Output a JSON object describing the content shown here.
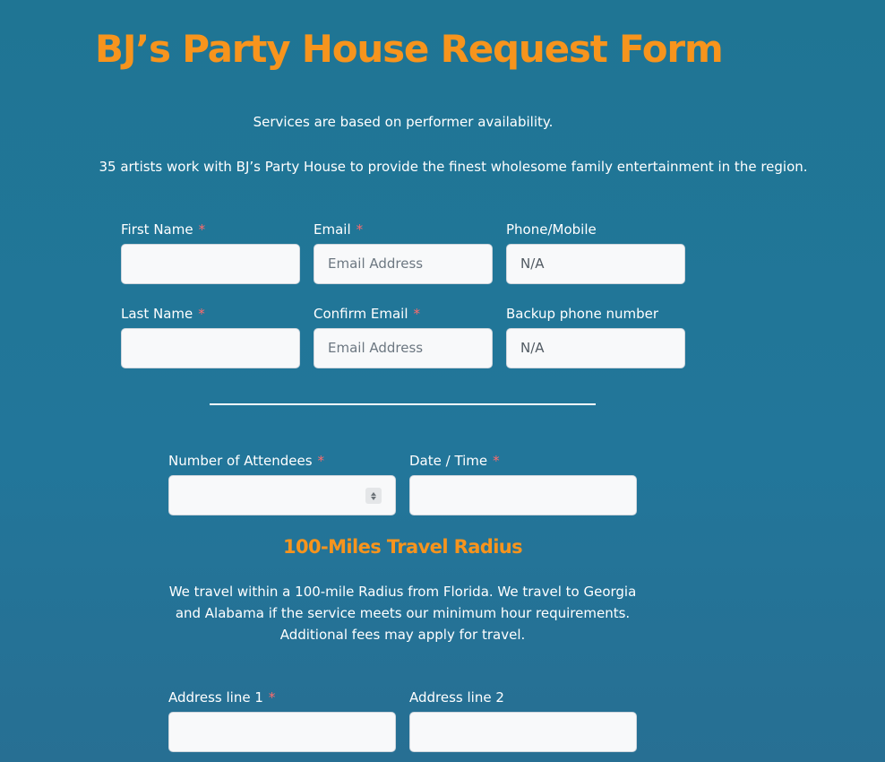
{
  "header": {
    "title": "BJ’s Party House Request Form",
    "intro_line_1": "Services are based on performer availability.",
    "intro_line_2": "35 artists work with BJ’s Party House to provide the finest wholesome family entertainment in the region."
  },
  "required_marker": "*",
  "contact_fields": {
    "first_name": {
      "label": "First Name",
      "value": ""
    },
    "email": {
      "label": "Email",
      "placeholder": "Email Address"
    },
    "phone": {
      "label": "Phone/Mobile",
      "value": "N/A"
    },
    "last_name": {
      "label": "Last Name",
      "value": ""
    },
    "confirm_email": {
      "label": "Confirm Email",
      "placeholder": "Email Address"
    },
    "backup_phone": {
      "label": "Backup phone number",
      "value": "N/A"
    }
  },
  "event_fields": {
    "attendees": {
      "label": "Number of Attendees",
      "value": ""
    },
    "date_time": {
      "label": "Date / Time",
      "value": ""
    }
  },
  "travel": {
    "heading": "100-Miles Travel Radius",
    "description": "We travel within a 100-mile Radius from Florida. We travel to Georgia and Alabama if the service meets our minimum hour requirements. Additional fees may apply for travel."
  },
  "address_fields": {
    "line1": {
      "label": "Address line 1",
      "value": ""
    },
    "line2": {
      "label": "Address line 2",
      "value": ""
    }
  },
  "colors": {
    "background": "#22769a",
    "accent": "#f7941d",
    "required": "#ff6b6b",
    "input_bg": "#f8f9fa"
  }
}
